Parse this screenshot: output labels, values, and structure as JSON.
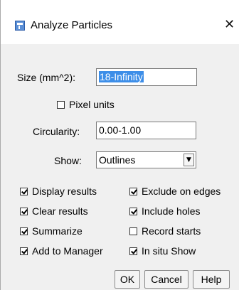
{
  "window": {
    "title": "Analyze Particles",
    "close_glyph": "✕"
  },
  "size": {
    "label": "Size (mm^2):",
    "value": "18-Infinity"
  },
  "pixel_units": {
    "label": "Pixel units",
    "checked": false
  },
  "circularity": {
    "label": "Circularity:",
    "value": "0.00-1.00"
  },
  "show": {
    "label": "Show:",
    "selected": "Outlines"
  },
  "options": {
    "display_results": {
      "label": "Display results",
      "checked": true
    },
    "exclude_on_edges": {
      "label": "Exclude on edges",
      "checked": true
    },
    "clear_results": {
      "label": "Clear results",
      "checked": true
    },
    "include_holes": {
      "label": "Include holes",
      "checked": true
    },
    "summarize": {
      "label": "Summarize",
      "checked": true
    },
    "record_starts": {
      "label": "Record starts",
      "checked": false
    },
    "add_to_manager": {
      "label": "Add to Manager",
      "checked": true
    },
    "in_situ_show": {
      "label": "In situ Show",
      "checked": true
    }
  },
  "buttons": {
    "ok": "OK",
    "cancel": "Cancel",
    "help": "Help"
  },
  "icons": {
    "app": "imagej-icon",
    "close": "close-icon",
    "dropdown": "chevron-down-icon"
  }
}
